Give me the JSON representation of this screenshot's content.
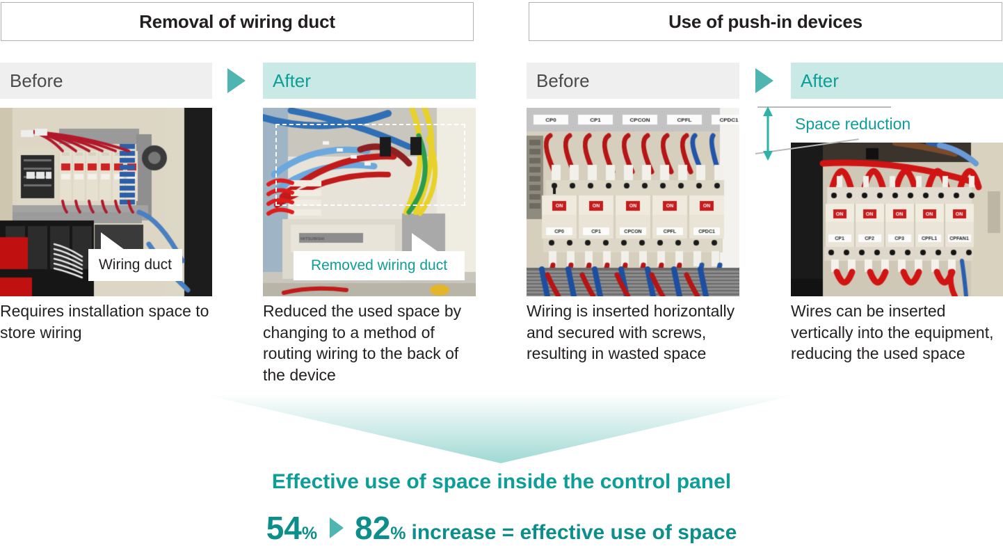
{
  "sections": [
    {
      "title": "Removal of wiring duct",
      "before": {
        "label": "Before",
        "caption": "Requires installation space to store wiring",
        "callout": "Wiring duct"
      },
      "after": {
        "label": "After",
        "caption": "Reduced the used space by changing to a method of routing wiring to the back of the device",
        "callout": "Removed wiring duct"
      }
    },
    {
      "title": "Use of push-in devices",
      "before": {
        "label": "Before",
        "caption": "Wiring is inserted horizontally and secured with screws, resulting in wasted space",
        "callout": ""
      },
      "after": {
        "label": "After",
        "caption": "Wires can be inserted vertically into the equipment, reducing the used space",
        "callout": "Space reduction"
      }
    }
  ],
  "conclusion": {
    "title": "Effective use of space inside the control panel",
    "from_value": "54",
    "from_unit": "%",
    "to_value": "82",
    "to_unit": "%",
    "tail_text": "increase = effective use of space"
  },
  "colors": {
    "teal": "#0e9e98",
    "teal_dark": "#0c8f8a",
    "teal_light": "#4fb5b0",
    "band_after_bg": "#c9e9e6",
    "band_before_bg": "#efefef",
    "text": "#231f20"
  },
  "photo_labels": {
    "panel3_top_row": [
      "CP0",
      "CP1",
      "CPCON",
      "CPFL",
      "CPDC1"
    ],
    "panel3_breakers": [
      "CP0",
      "CP1",
      "CPCON",
      "CPFL",
      "CPDC1"
    ],
    "panel3_switch_state": "ON",
    "panel4_breakers": [
      "CP1",
      "CP2",
      "CP3",
      "CPFL1",
      "CPFAN1"
    ],
    "panel4_switch_state": "ON"
  }
}
